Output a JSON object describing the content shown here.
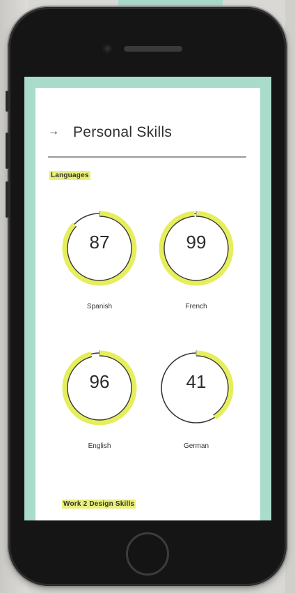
{
  "header": {
    "back_icon": "→",
    "title": "Personal Skills"
  },
  "languages": {
    "heading": "Languages",
    "skills": [
      {
        "value": "87",
        "label": "Spanish",
        "fraction": 0.87
      },
      {
        "value": "99",
        "label": "French",
        "fraction": 0.99
      },
      {
        "value": "96",
        "label": "English",
        "fraction": 0.96
      },
      {
        "value": "41",
        "label": "German",
        "fraction": 0.41
      }
    ]
  },
  "work_section": {
    "heading": "Work 2 Design Skills"
  },
  "colors": {
    "accent": "#e6ee5c",
    "ring": "#3a3a3a",
    "screen_border": "#a9dccb"
  }
}
